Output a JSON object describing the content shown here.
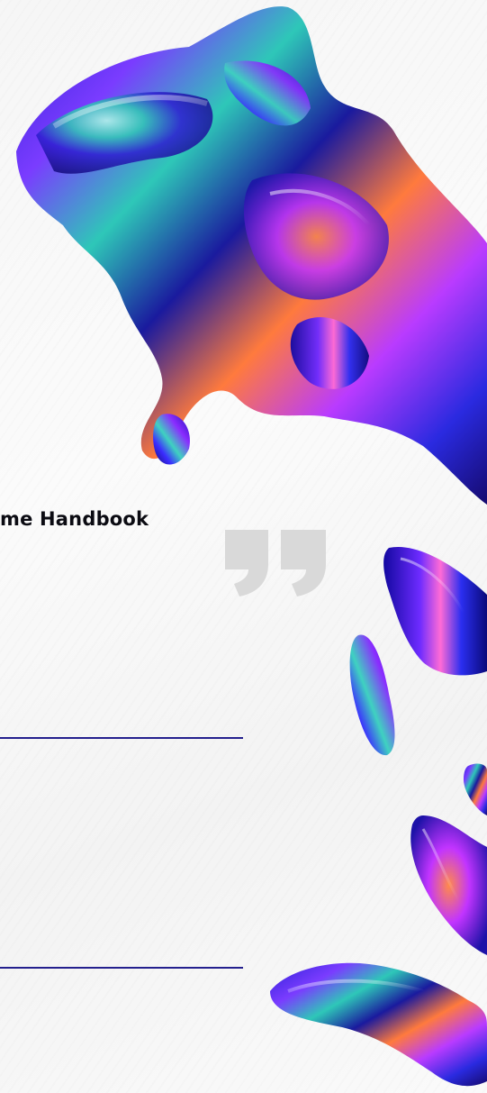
{
  "page": {
    "title": "me Handbook"
  },
  "decorations": {
    "quote_icon": "closing-quote-icon",
    "artwork": "iridescent-liquid-sculpture",
    "quote_color": "#d9d9d9",
    "rule_color": "#24208e"
  }
}
